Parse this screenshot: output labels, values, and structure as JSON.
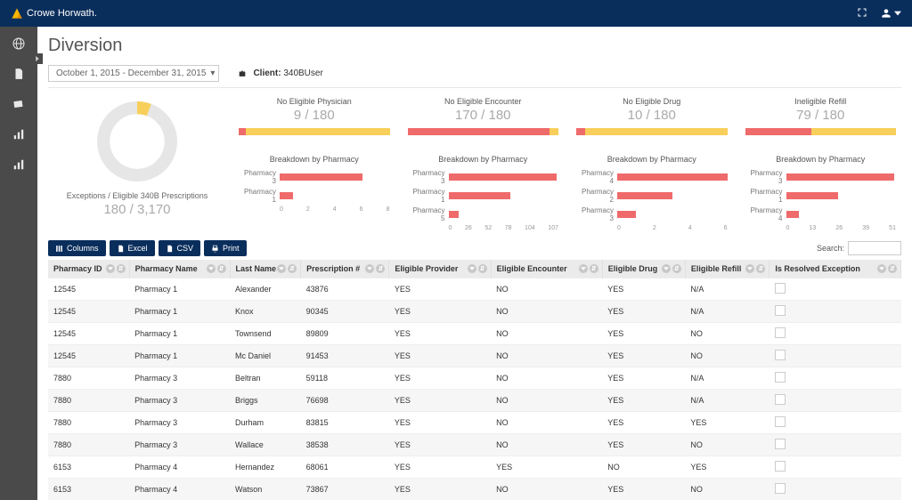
{
  "brand": "Crowe Horwath.",
  "page_title": "Diversion",
  "date_range": "October 1, 2015 - December 31, 2015",
  "client": {
    "label": "Client:",
    "value": "340BUser"
  },
  "donut": {
    "caption": "Exceptions / Eligible 340B Prescriptions",
    "value": "180 / 3,170",
    "pct": 5.7
  },
  "kpis": [
    {
      "title": "No Eligible Physician",
      "value": "9 / 180",
      "pct": 5
    },
    {
      "title": "No Eligible Encounter",
      "value": "170 / 180",
      "pct": 94
    },
    {
      "title": "No Eligible Drug",
      "value": "10 / 180",
      "pct": 6
    },
    {
      "title": "Ineligible Refill",
      "value": "79 / 180",
      "pct": 44
    }
  ],
  "breakdown_titles": [
    "Breakdown by Pharmacy",
    "Breakdown by Pharmacy",
    "Breakdown by Pharmacy",
    "Breakdown by Pharmacy"
  ],
  "chart_data": [
    {
      "type": "bar",
      "title": "Breakdown by Pharmacy",
      "parent": "No Eligible Physician",
      "categories": [
        "Pharmacy 3",
        "Pharmacy 1"
      ],
      "values": [
        6,
        1
      ],
      "xticks": [
        0,
        2,
        4,
        6,
        8
      ],
      "xmax": 8
    },
    {
      "type": "bar",
      "title": "Breakdown by Pharmacy",
      "parent": "No Eligible Encounter",
      "categories": [
        "Pharmacy 3",
        "Pharmacy 1",
        "Pharmacy 5"
      ],
      "values": [
        105,
        60,
        10
      ],
      "xticks": [
        0,
        26,
        52,
        78,
        104,
        107
      ],
      "xmax": 107
    },
    {
      "type": "bar",
      "title": "Breakdown by Pharmacy",
      "parent": "No Eligible Drug",
      "categories": [
        "Pharmacy 4",
        "Pharmacy 2",
        "Pharmacy 3"
      ],
      "values": [
        6,
        3,
        1
      ],
      "xticks": [
        0,
        2,
        4,
        6
      ],
      "xmax": 6
    },
    {
      "type": "bar",
      "title": "Breakdown by Pharmacy",
      "parent": "Ineligible Refill",
      "categories": [
        "Pharmacy 3",
        "Pharmacy 1",
        "Pharmacy 4"
      ],
      "values": [
        50,
        24,
        6
      ],
      "xticks": [
        0,
        13,
        26,
        39,
        51
      ],
      "xmax": 51
    }
  ],
  "buttons": {
    "columns": "Columns",
    "excel": "Excel",
    "csv": "CSV",
    "print": "Print"
  },
  "search_label": "Search:",
  "columns": [
    "Pharmacy ID",
    "Pharmacy Name",
    "Last Name",
    "Prescription #",
    "Eligible Provider",
    "Eligible Encounter",
    "Eligible Drug",
    "Eligible Refill",
    "Is Resolved Exception"
  ],
  "rows": [
    [
      "12545",
      "Pharmacy 1",
      "Alexander",
      "43876",
      "YES",
      "NO",
      "YES",
      "N/A"
    ],
    [
      "12545",
      "Pharmacy 1",
      "Knox",
      "90345",
      "YES",
      "NO",
      "YES",
      "N/A"
    ],
    [
      "12545",
      "Pharmacy 1",
      "Townsend",
      "89809",
      "YES",
      "NO",
      "YES",
      "NO"
    ],
    [
      "12545",
      "Pharmacy 1",
      "Mc Daniel",
      "91453",
      "YES",
      "NO",
      "YES",
      "NO"
    ],
    [
      "7880",
      "Pharmacy 3",
      "Beltran",
      "59118",
      "YES",
      "NO",
      "YES",
      "N/A"
    ],
    [
      "7880",
      "Pharmacy 3",
      "Briggs",
      "76698",
      "YES",
      "NO",
      "YES",
      "N/A"
    ],
    [
      "7880",
      "Pharmacy 3",
      "Durham",
      "83815",
      "YES",
      "NO",
      "YES",
      "YES"
    ],
    [
      "7880",
      "Pharmacy 3",
      "Wallace",
      "38538",
      "YES",
      "NO",
      "YES",
      "NO"
    ],
    [
      "6153",
      "Pharmacy 4",
      "Hernandez",
      "68061",
      "YES",
      "YES",
      "NO",
      "YES"
    ],
    [
      "6153",
      "Pharmacy 4",
      "Watson",
      "73867",
      "YES",
      "NO",
      "YES",
      "NO"
    ]
  ]
}
